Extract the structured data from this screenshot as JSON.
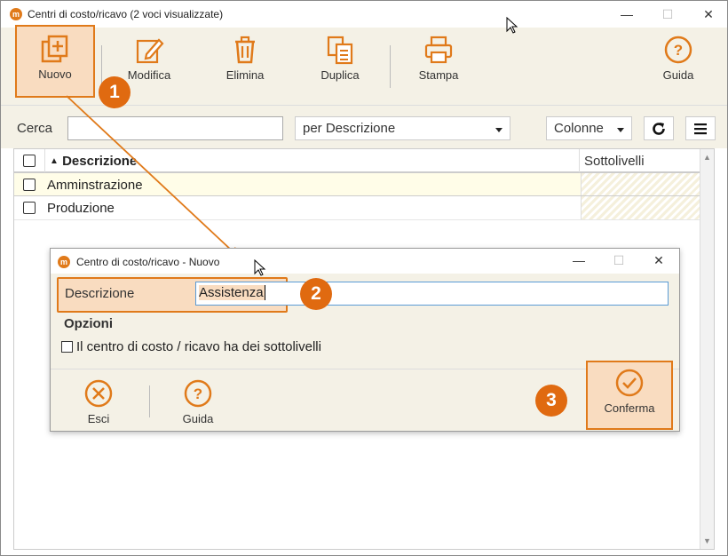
{
  "window": {
    "title": "Centri di costo/ricavo (2 voci visualizzate)",
    "logo": "m"
  },
  "toolbar": {
    "nuovo": "Nuovo",
    "modifica": "Modifica",
    "elimina": "Elimina",
    "duplica": "Duplica",
    "stampa": "Stampa",
    "guida": "Guida"
  },
  "search": {
    "label": "Cerca",
    "value": "",
    "mode": "per Descrizione",
    "columns": "Colonne"
  },
  "grid": {
    "headers": [
      "Descrizione",
      "Sottolivelli"
    ],
    "rows": [
      "Amminstrazione",
      "Produzione"
    ]
  },
  "dialog": {
    "title": "Centro di costo/ricavo - Nuovo",
    "logo": "m",
    "descrizione_label": "Descrizione",
    "descrizione_value": "Assistenza",
    "opzioni_label": "Opzioni",
    "checkbox_label": "Il centro di costo / ricavo ha dei sottolivelli",
    "esci": "Esci",
    "guida": "Guida",
    "conferma": "Conferma"
  },
  "annotations": {
    "badge1": "1",
    "badge2": "2",
    "badge3": "3"
  },
  "colors": {
    "accent": "#e07a1a",
    "toolbar_bg": "#f4f1e6",
    "badge": "#e06a10"
  }
}
